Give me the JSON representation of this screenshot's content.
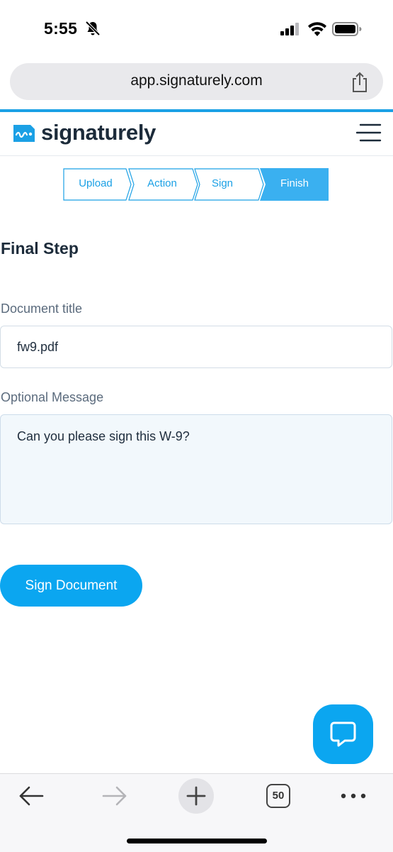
{
  "status_bar": {
    "time": "5:55"
  },
  "browser": {
    "url": "app.signaturely.com",
    "tab_count": "50"
  },
  "app": {
    "logo_text": "signaturely"
  },
  "stepper": {
    "steps": [
      "Upload",
      "Action",
      "Sign",
      "Finish"
    ],
    "active_step": "Finish"
  },
  "form": {
    "title": "Final Step",
    "document_title_label": "Document title",
    "document_title_value": "fw9.pdf",
    "message_label": "Optional Message",
    "message_value": "Can you please sign this W-9?",
    "submit_label": "Sign Document"
  },
  "colors": {
    "accent": "#0ba6f0",
    "brand": "#1ba0e5",
    "text_dark": "#1c2b3a"
  },
  "icons": [
    "bell-slash-icon",
    "signal-icon",
    "wifi-icon",
    "battery-icon",
    "share-icon",
    "signaturely-logo-icon",
    "hamburger-menu-icon",
    "chat-icon",
    "back-arrow-icon",
    "forward-arrow-icon",
    "new-tab-plus-icon",
    "tabs-icon",
    "more-icon"
  ]
}
